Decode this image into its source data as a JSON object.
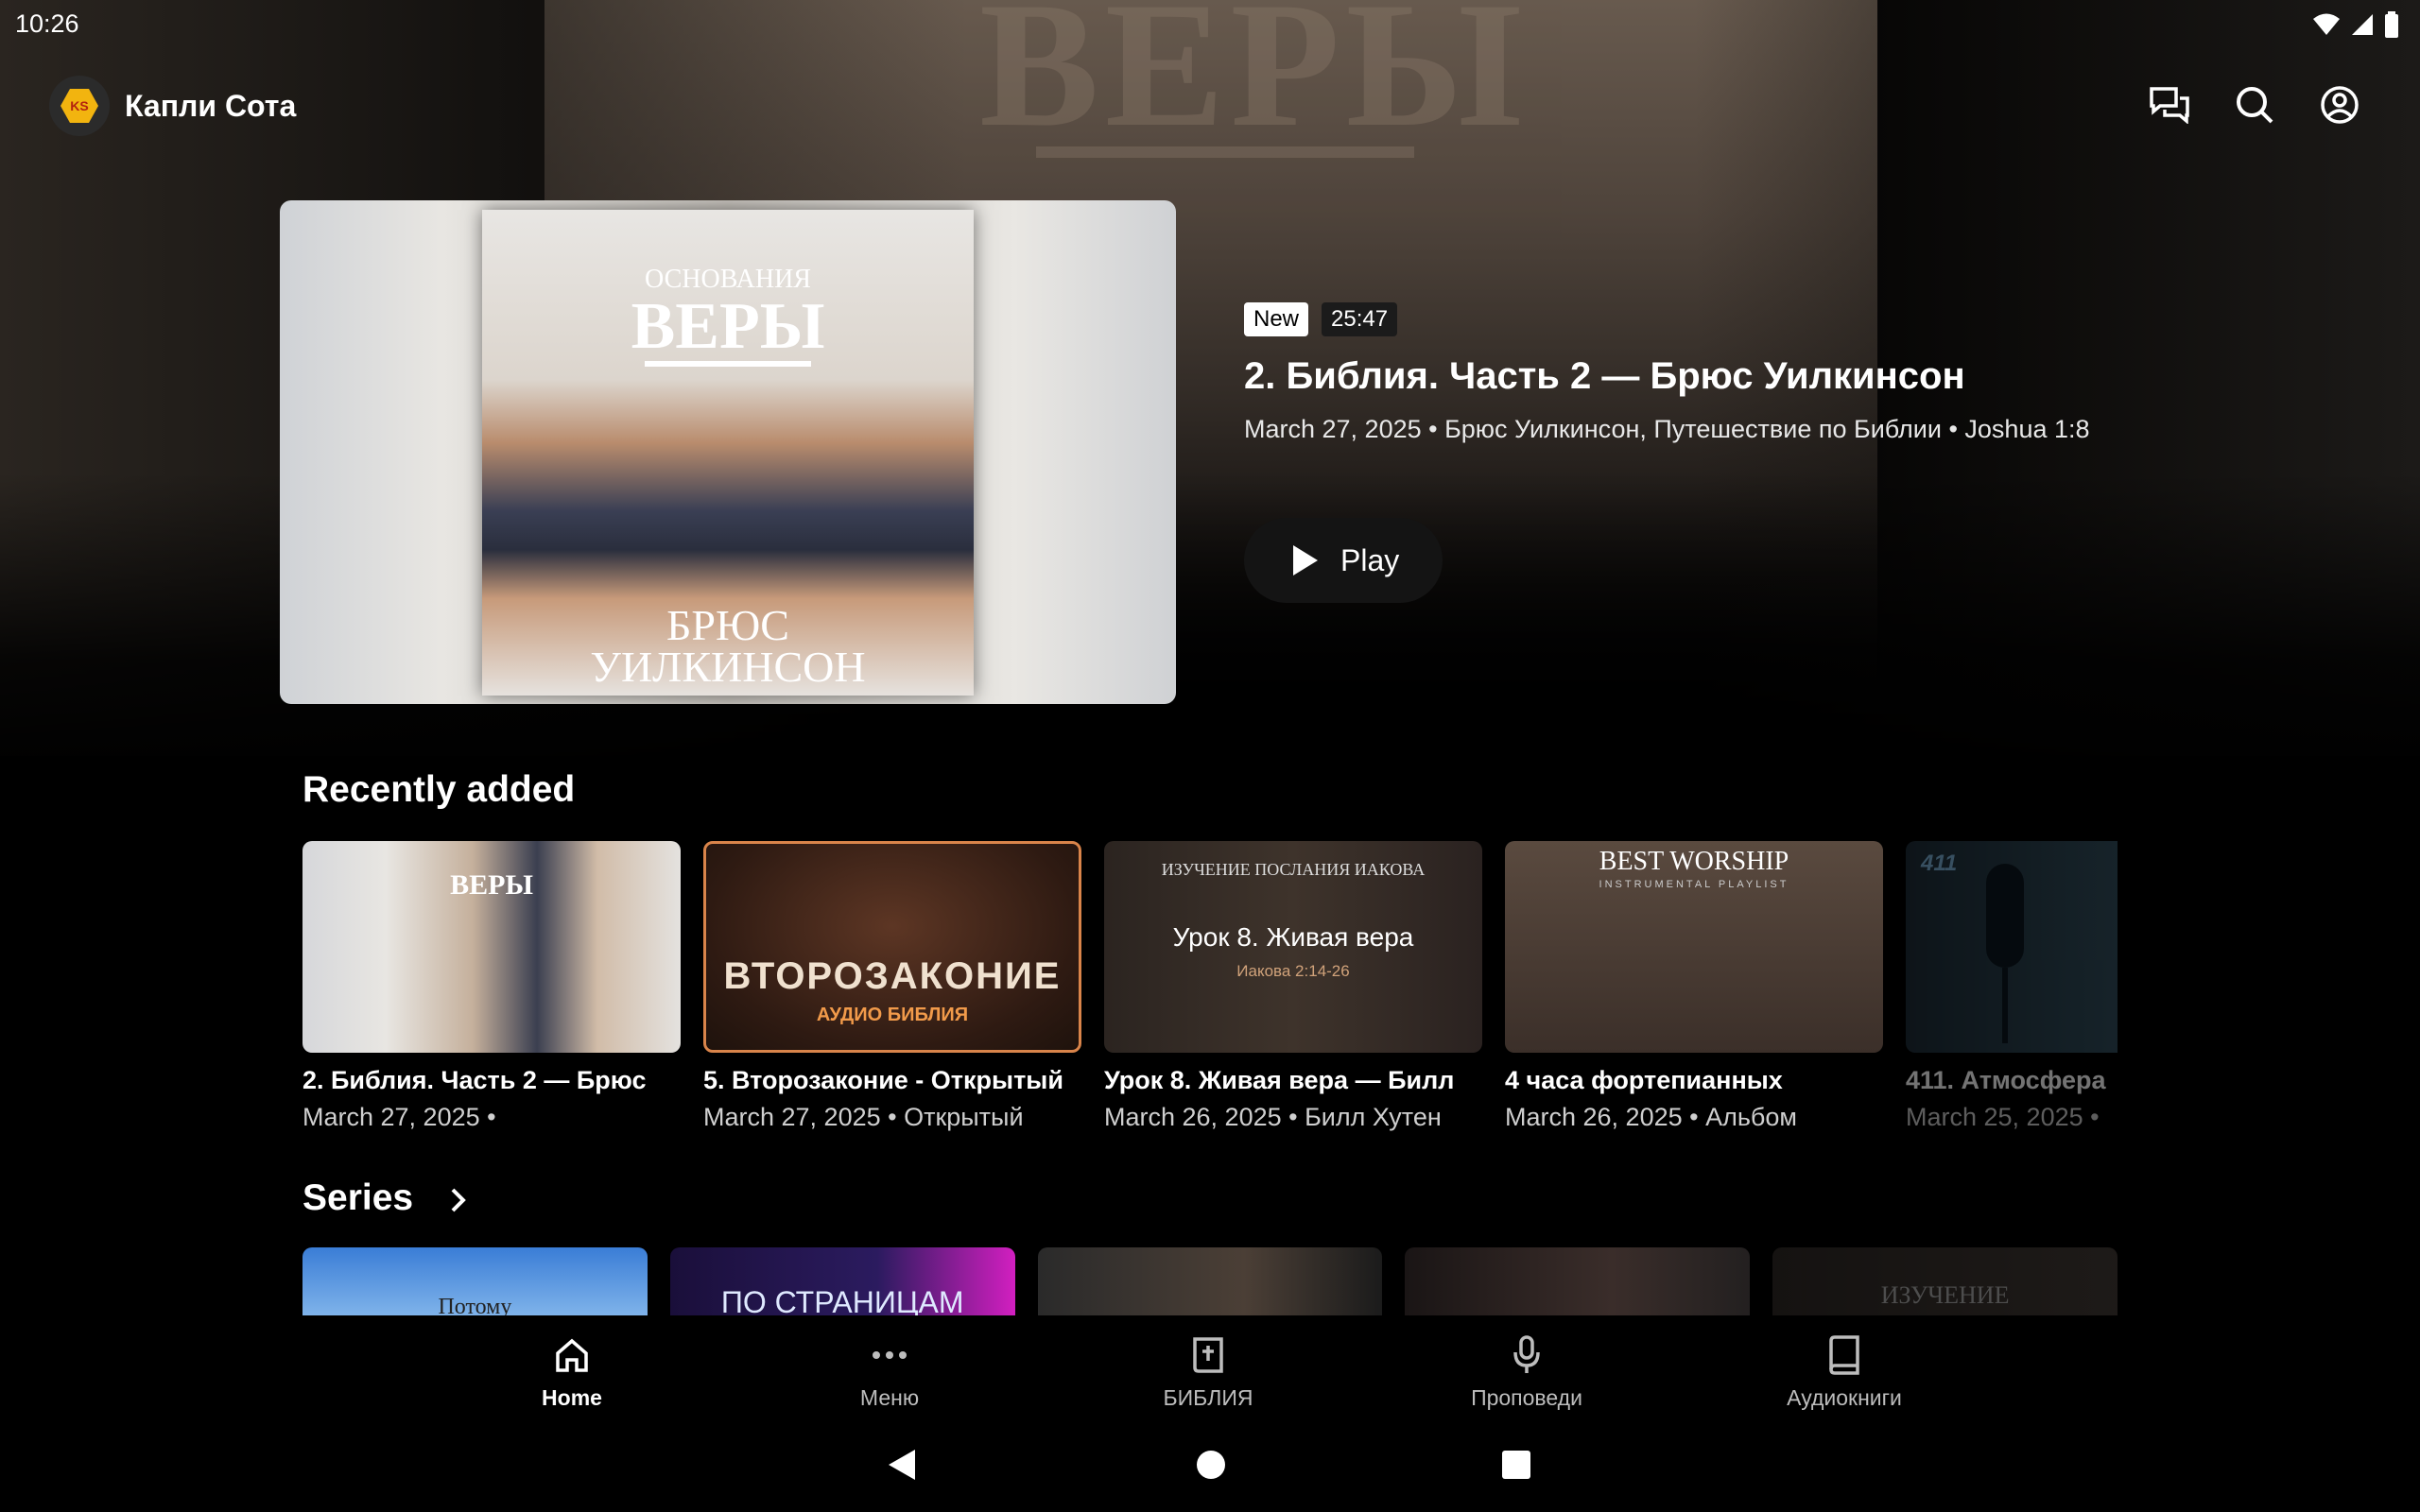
{
  "status": {
    "time": "10:26"
  },
  "app": {
    "title": "Капли Сота",
    "logo_text": "KS"
  },
  "hero": {
    "badge_new": "New",
    "duration": "25:47",
    "title": "2. Библия. Часть 2 — Брюс Уилкинсон",
    "meta": "March 27, 2025 • Брюс Уилкинсон, Путешествие по Библии • Joshua 1:8",
    "play_label": "Play",
    "cover": {
      "kicker": "ОСНОВАНИЯ",
      "title": "ВЕРЫ",
      "author_line1": "БРЮС",
      "author_line2": "УИЛКИНСОН"
    }
  },
  "recent": {
    "title": "Recently added",
    "items": [
      {
        "title": "2. Библия. Часть 2 — Брюс",
        "meta": "March 27, 2025 •"
      },
      {
        "title": "5. Второзаконие - Открытый",
        "meta": "March 27, 2025 • Открытый",
        "thumb_title": "ВТОРОЗАКОНИЕ",
        "thumb_sub": "АУДИО БИБЛИЯ"
      },
      {
        "title": "Урок 8. Живая вера — Билл",
        "meta": "March 26, 2025 • Билл Хутен",
        "thumb_kicker": "ИЗУЧЕНИЕ ПОСЛАНИЯ ИАКОВА",
        "thumb_title": "Урок 8. Живая вера",
        "thumb_sub": "Иакова 2:14-26"
      },
      {
        "title": "4 часа фортепианных",
        "meta": "March 26, 2025 • Альбом",
        "thumb_title": "BEST WORSHIP",
        "thumb_sub": "INSTRUMENTAL PLAYLIST"
      },
      {
        "title": "411. Атмосфера",
        "meta": "March 25, 2025 •",
        "thumb_title": "411"
      }
    ]
  },
  "series": {
    "title": "Series",
    "items": [
      {
        "thumb_text": "Потому"
      },
      {
        "thumb_text": "ПО СТРАНИЦАМ"
      },
      {
        "thumb_text": ""
      },
      {
        "thumb_text": ""
      },
      {
        "thumb_text": "ИЗУЧЕНИЕ"
      }
    ]
  },
  "nav": {
    "items": [
      {
        "label": "Home",
        "icon": "home-icon",
        "active": true
      },
      {
        "label": "Меню",
        "icon": "more-icon"
      },
      {
        "label": "БИБЛИЯ",
        "icon": "bible-icon"
      },
      {
        "label": "Проповеди",
        "icon": "microphone-icon"
      },
      {
        "label": "Аудиокниги",
        "icon": "book-icon"
      }
    ]
  }
}
